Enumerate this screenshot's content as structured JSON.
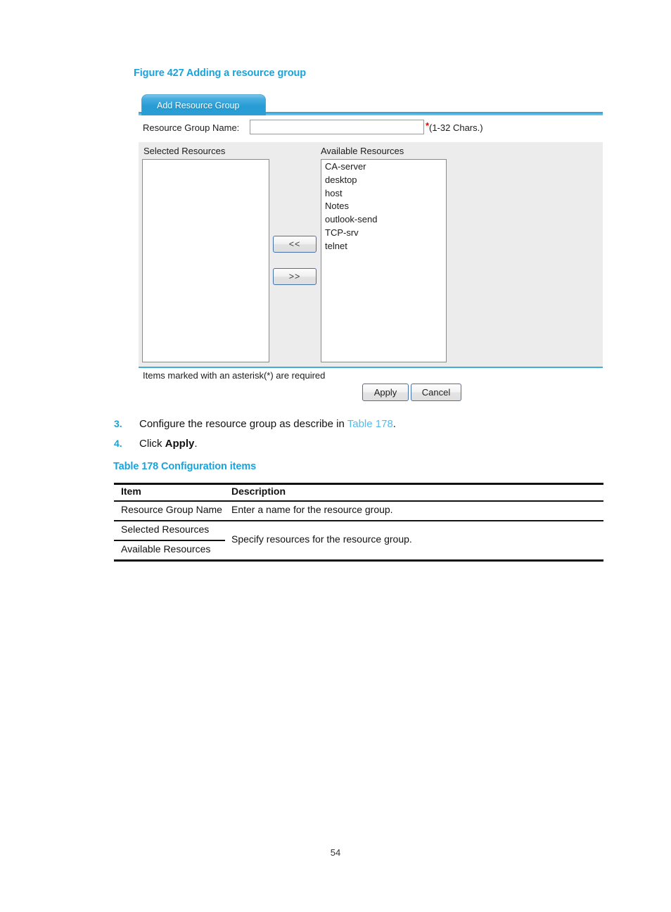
{
  "figure": {
    "caption": "Figure 427 Adding a resource group"
  },
  "screenshot": {
    "tab": {
      "label": "Add Resource Group"
    },
    "form": {
      "name_label": "Resource Group Name:",
      "name_value": "",
      "name_placeholder": "",
      "required_marker": "*",
      "chars_hint": "(1-32 Chars.)",
      "selected_title": "Selected Resources",
      "available_title": "Available Resources",
      "selected_resources": [],
      "available_resources": [
        "CA-server",
        "desktop",
        "host",
        "Notes",
        "outlook-send",
        "TCP-srv",
        "telnet"
      ],
      "move_left_label": "<<",
      "move_right_label": ">>",
      "asterisk_note": "Items marked with an asterisk(*) are required",
      "apply_label": "Apply",
      "cancel_label": "Cancel"
    }
  },
  "steps": [
    {
      "number": "3.",
      "text_before": "Configure the resource group as describe in ",
      "xref": "Table 178",
      "text_after": "."
    },
    {
      "number": "4.",
      "text_before": "Click ",
      "bold": "Apply",
      "text_after": "."
    }
  ],
  "table": {
    "caption": "Table 178 Configuration items",
    "headers": [
      "Item",
      "Description"
    ],
    "rows": [
      {
        "item": "Resource Group Name",
        "description": "Enter a name for the resource group."
      },
      {
        "item": "Selected Resources",
        "description": "Specify resources for the resource group."
      },
      {
        "item": "Available Resources",
        "description": ""
      }
    ]
  },
  "footer": {
    "page_number": "54"
  },
  "colors": {
    "accent_blue": "#18A3DC",
    "xref_blue": "#55BCE8",
    "tab_blue": "#2C9ED6",
    "required_red": "#e60000",
    "panel_gray": "#ececec"
  }
}
